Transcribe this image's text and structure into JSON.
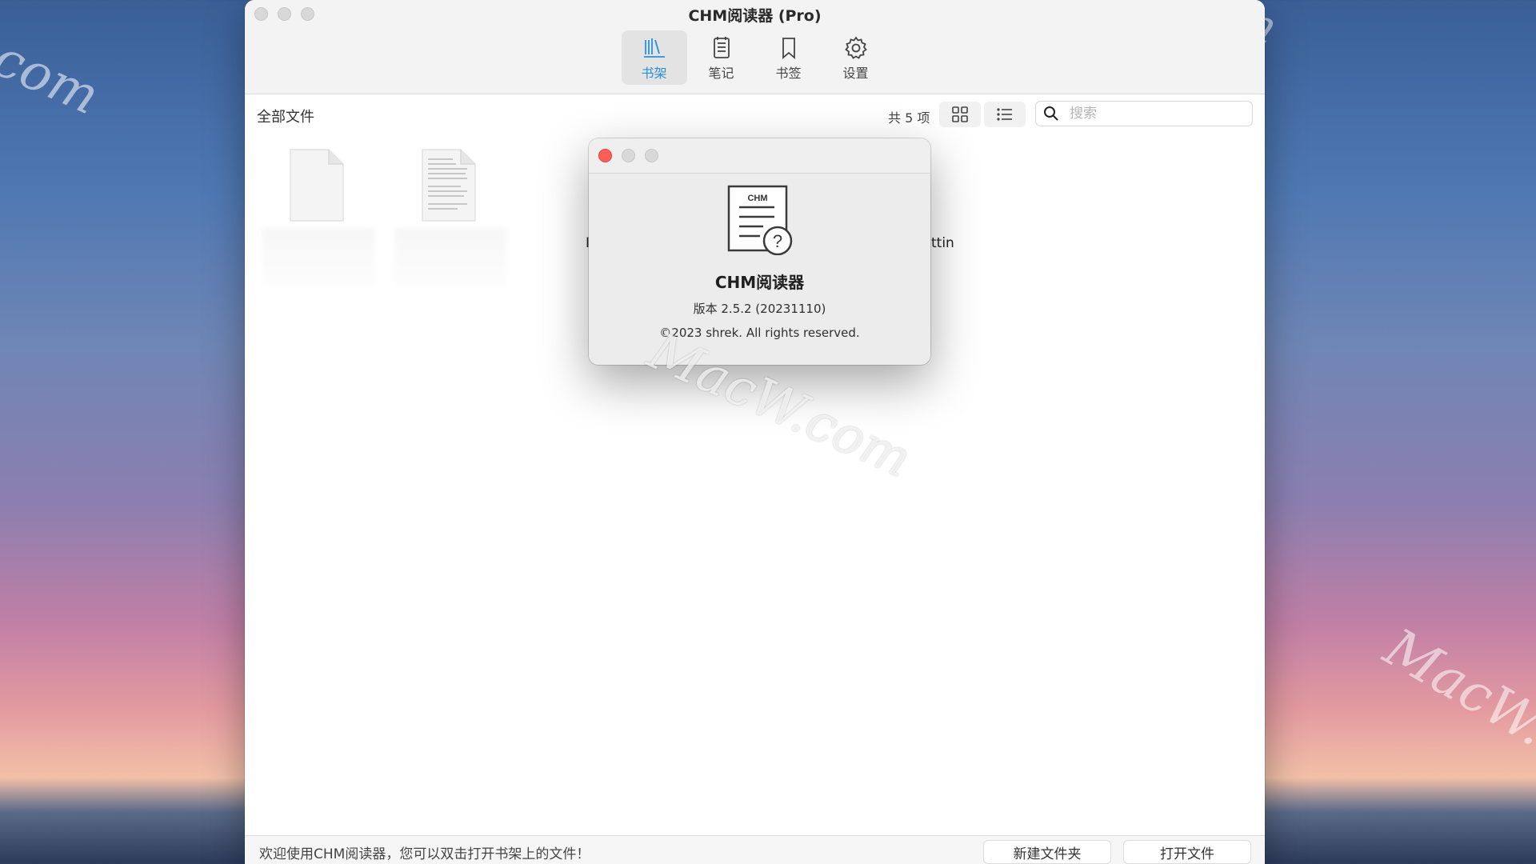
{
  "window": {
    "title": "CHM阅读器 (Pro)"
  },
  "toolbar": {
    "items": [
      {
        "label": "书架",
        "icon": "bookshelf-icon",
        "active": true
      },
      {
        "label": "笔记",
        "icon": "notes-icon",
        "active": false
      },
      {
        "label": "书签",
        "icon": "bookmark-icon",
        "active": false
      },
      {
        "label": "设置",
        "icon": "gear-icon",
        "active": false
      }
    ]
  },
  "pathbar": {
    "label": "全部文件",
    "count": "共 5 项",
    "search_placeholder": "搜索"
  },
  "files": {
    "partial_label_left": "I",
    "partial_label_right": "ttin"
  },
  "statusbar": {
    "message": "欢迎使用CHM阅读器，您可以双击打开书架上的文件！",
    "new_folder": "新建文件夹",
    "open_file": "打开文件"
  },
  "about": {
    "icon_text": "CHM",
    "app_name": "CHM阅读器",
    "version": "版本 2.5.2 (20231110)",
    "copyright": "©2023 shrek. All rights reserved."
  },
  "watermarks": {
    "left": "com",
    "top_right": "com",
    "center": "MacW.com",
    "bottom_right": "MacW.c"
  },
  "colors": {
    "accent": "#2b8fd8",
    "close_red": "#ff5f57"
  }
}
